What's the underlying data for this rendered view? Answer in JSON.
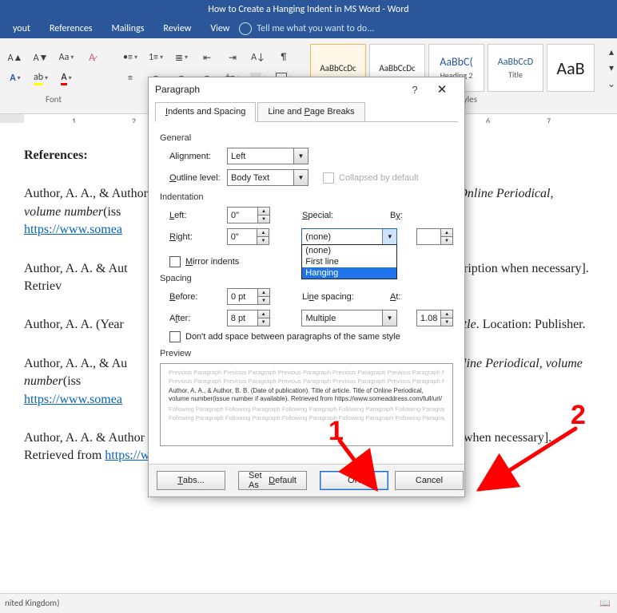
{
  "title": "How to Create a Hanging Indent in MS Word - Word",
  "ribbon_tabs": [
    "yout",
    "References",
    "Mailings",
    "Review",
    "View"
  ],
  "tellme": "Tell me what you want to do...",
  "group_font": "Font",
  "group_styles": "Styles",
  "styles": [
    {
      "sample": "AaBbCcDc",
      "label": ""
    },
    {
      "sample": "AaBbCcDc",
      "label": ""
    },
    {
      "sample": "AaBbC(",
      "label": "Heading 2"
    },
    {
      "sample": "AaBbCcD",
      "label": "Title"
    },
    {
      "sample": "AaB",
      "label": ""
    }
  ],
  "ruler_ticks": [
    "1",
    "2",
    "6",
    "7"
  ],
  "page": {
    "refs_heading": "References:",
    "p1a": "Author, A. A., & Author",
    "p1b": "f Online Periodical, volume number",
    "p1c": "(iss",
    "p1d": "https://www.somea",
    "p2a": "Author, A. A. & Aut",
    "p2b": "escription when necessary]. Retriev",
    "p3a": "Author, A. A. (Year",
    "p3b": "ubtitle",
    "p3c": ". Location: Publisher.",
    "p4a": "Author, A. A., & Au",
    "p4b": "f Online Periodical, volume number",
    "p4c": "(iss",
    "p4d": "https://www.somea",
    "p5a": "Author, A. A. & Author B. B. (Date of publication). Title of page [Format description when necessary]. Retrieved from ",
    "p5link": "https://www.someaddress.com/full/url/"
  },
  "dialog": {
    "title": "Paragraph",
    "tab1": "Indents and Spacing",
    "tab2": "Line and Page Breaks",
    "sec_general": "General",
    "alignment_label": "Alignment:",
    "alignment_value": "Left",
    "outline_label": "Outline level:",
    "outline_value": "Body Text",
    "collapsed": "Collapsed by default",
    "sec_indent": "Indentation",
    "left_label": "Left:",
    "left_value": "0\"",
    "right_label": "Right:",
    "right_value": "0\"",
    "special_label": "Special:",
    "special_value": "(none)",
    "by_label": "By:",
    "by_value": "",
    "mirror": "Mirror indents",
    "special_options": [
      "(none)",
      "First line",
      "Hanging"
    ],
    "sec_spacing": "Spacing",
    "before_label": "Before:",
    "before_value": "0 pt",
    "after_label": "After:",
    "after_value": "8 pt",
    "linespacing_label": "Line spacing:",
    "linespacing_value": "Multiple",
    "at_label": "At:",
    "at_value": "1.08",
    "noadd": "Don't add space between paragraphs of the same style",
    "sec_preview": "Preview",
    "pv_prev": "Previous Paragraph Previous Paragraph Previous Paragraph Previous Paragraph Previous Paragraph Previous Paragraph Previous Paragraph Previous Paragraph Previous Paragraph Previous Paragraph",
    "pv_sample": "Author, A. A., & Author, B. B. (Date of publication). Title of article. Title of Online Periodical, volume number(issue number if available). Retrieved from https://www.someaddress.com/full/url/",
    "pv_next": "Following Paragraph Following Paragraph Following Paragraph Following Paragraph Following Paragraph Following Paragraph Following Paragraph Following Paragraph Following Paragraph Following Paragraph",
    "btn_tabs": "Tabs...",
    "btn_default": "Set As Default",
    "btn_ok": "OK",
    "btn_cancel": "Cancel"
  },
  "status": {
    "left": "nited Kingdom)",
    "book": "📖"
  },
  "anno": {
    "n1": "1",
    "n2": "2"
  }
}
